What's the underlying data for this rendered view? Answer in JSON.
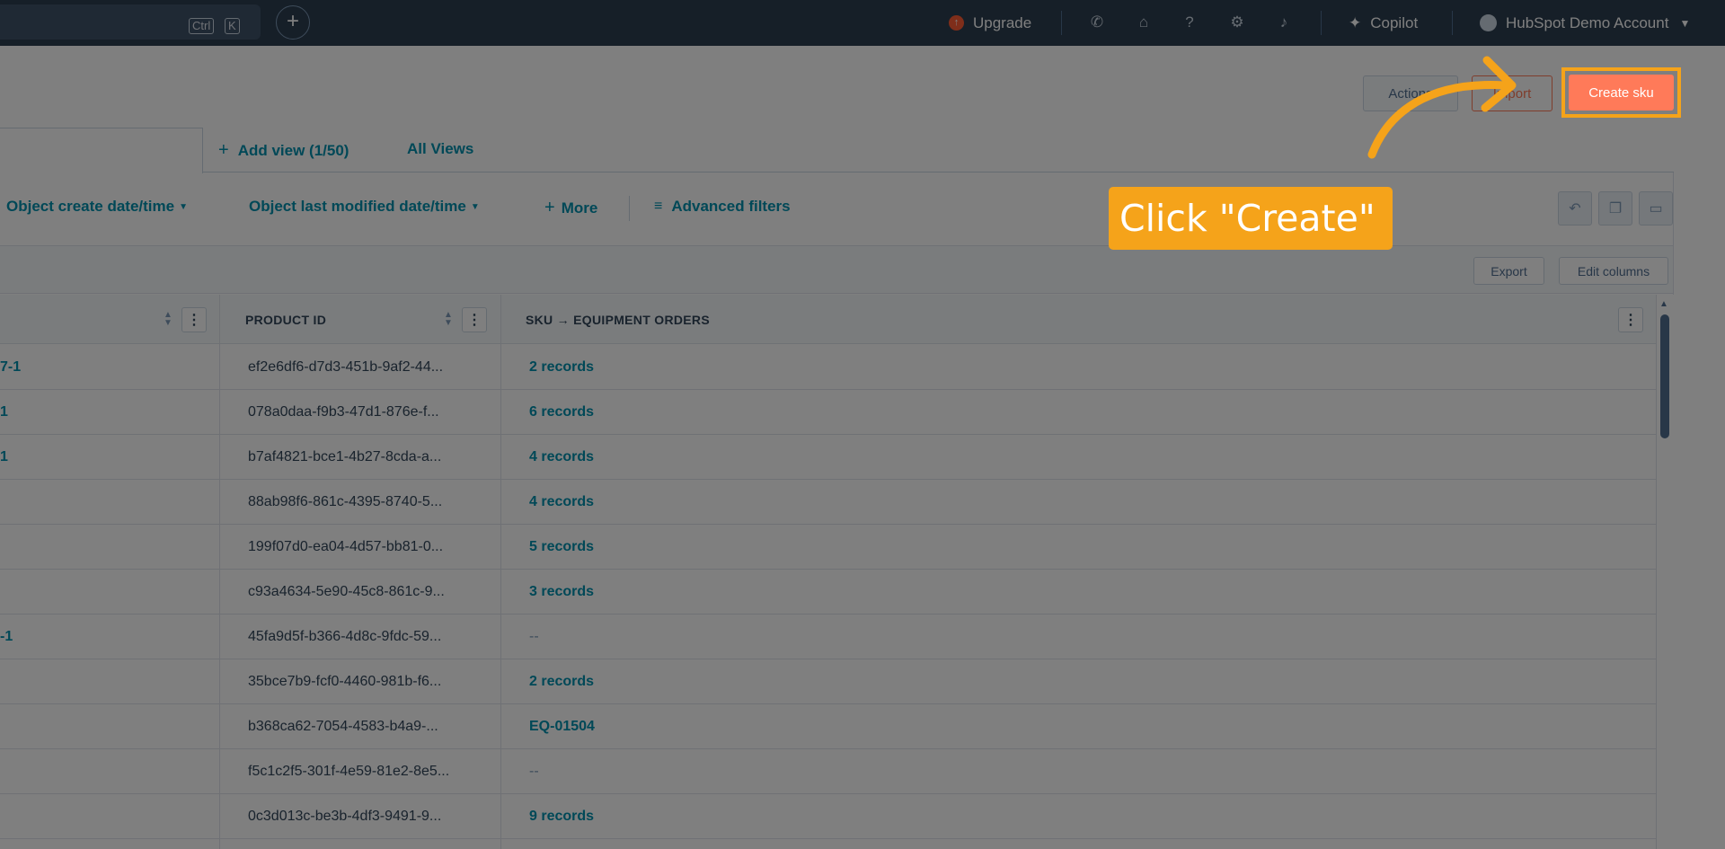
{
  "topnav": {
    "search_kbd_ctrl": "Ctrl",
    "search_kbd_k": "K",
    "upgrade_label": "Upgrade",
    "copilot_label": "Copilot",
    "account_label": "HubSpot Demo Account"
  },
  "header": {
    "actions_label": "Actions",
    "import_label": "Import",
    "create_label": "Create sku"
  },
  "tabs": {
    "add_view_label": "Add view (1/50)",
    "all_views_label": "All Views"
  },
  "filters": {
    "create_date": "Object create date/time",
    "modified_date": "Object last modified date/time",
    "more": "More",
    "advanced": "Advanced filters"
  },
  "toolbar": {
    "export_label": "Export",
    "edit_columns_label": "Edit columns"
  },
  "table": {
    "col_product_id": "PRODUCT ID",
    "col_orders": "SKU → EQUIPMENT ORDERS",
    "rows": [
      {
        "name": "7-1",
        "pid": "ef2e6df6-d7d3-451b-9af2-44...",
        "orders": "2 records"
      },
      {
        "name": "1",
        "pid": "078a0daa-f9b3-47d1-876e-f...",
        "orders": "6 records"
      },
      {
        "name": "1",
        "pid": "b7af4821-bce1-4b27-8cda-a...",
        "orders": "4 records"
      },
      {
        "name": "",
        "pid": "88ab98f6-861c-4395-8740-5...",
        "orders": "4 records"
      },
      {
        "name": "",
        "pid": "199f07d0-ea04-4d57-bb81-0...",
        "orders": "5 records"
      },
      {
        "name": "",
        "pid": "c93a4634-5e90-45c8-861c-9...",
        "orders": "3 records"
      },
      {
        "name": "-1",
        "pid": "45fa9d5f-b366-4d8c-9fdc-59...",
        "orders": "--"
      },
      {
        "name": "",
        "pid": "35bce7b9-fcf0-4460-981b-f6...",
        "orders": "2 records"
      },
      {
        "name": "",
        "pid": "b368ca62-7054-4583-b4a9-...",
        "orders": "EQ-01504"
      },
      {
        "name": "",
        "pid": "f5c1c2f5-301f-4e59-81e2-8e5...",
        "orders": "--"
      },
      {
        "name": "",
        "pid": "0c3d013c-be3b-4df3-9491-9...",
        "orders": "9 records"
      }
    ]
  },
  "tutorial": {
    "callout_text": "Click \"Create\""
  }
}
